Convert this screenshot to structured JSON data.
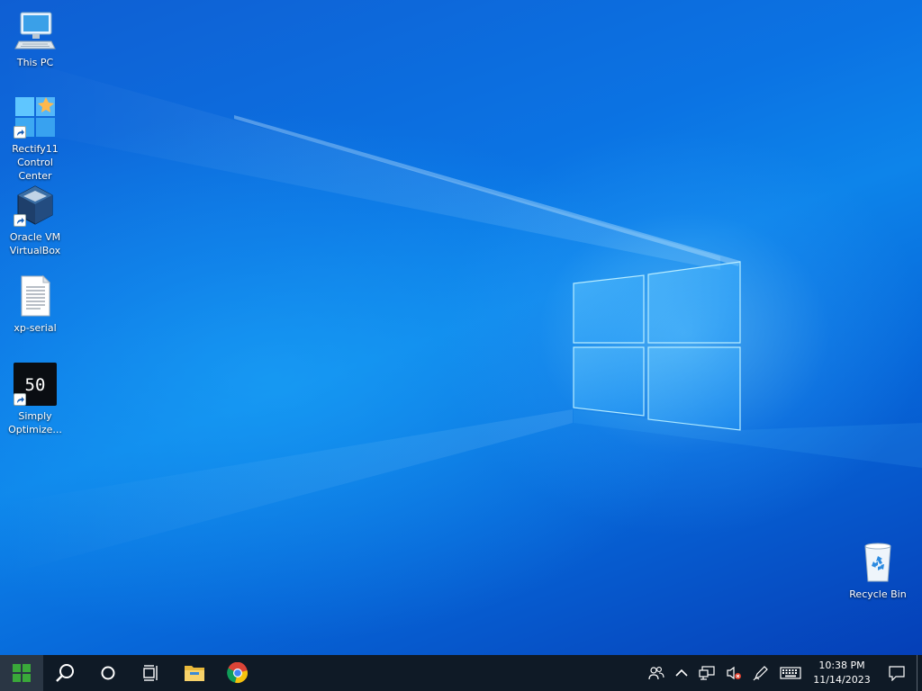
{
  "desktop": {
    "icons": [
      {
        "label": "This PC",
        "icon": "computer-icon",
        "shortcut": false
      },
      {
        "label": "Rectify11\nControl\nCenter",
        "icon": "rectify11-icon",
        "shortcut": true
      },
      {
        "label": "Oracle VM\nVirtualBox",
        "icon": "virtualbox-icon",
        "shortcut": true
      },
      {
        "label": "xp-serial",
        "icon": "text-file-icon",
        "shortcut": false
      },
      {
        "label": "Simply\nOptimize...",
        "icon": "simply-optimize-icon",
        "shortcut": true,
        "badge_text": "50"
      },
      {
        "label": "Recycle Bin",
        "icon": "recycle-bin-icon",
        "shortcut": false
      }
    ]
  },
  "taskbar": {
    "buttons": [
      {
        "name": "start",
        "icon": "windows-logo-icon"
      },
      {
        "name": "search",
        "icon": "search-icon"
      },
      {
        "name": "cortana",
        "icon": "cortana-icon"
      },
      {
        "name": "task-view",
        "icon": "task-view-icon"
      },
      {
        "name": "file-explorer",
        "icon": "folder-icon"
      },
      {
        "name": "chrome",
        "icon": "chrome-icon"
      }
    ],
    "tray": {
      "icons": [
        "people-icon",
        "chevron-up-icon",
        "network-icon",
        "volume-muted-icon",
        "pen-icon",
        "keyboard-icon"
      ],
      "time": "10:38 PM",
      "date": "11/14/2023",
      "notification_icon": "action-center-icon"
    }
  },
  "colors": {
    "taskbar": "#0f1a26",
    "wallpaper_base": "#0a63d6",
    "accent_green": "#3aa83a"
  }
}
